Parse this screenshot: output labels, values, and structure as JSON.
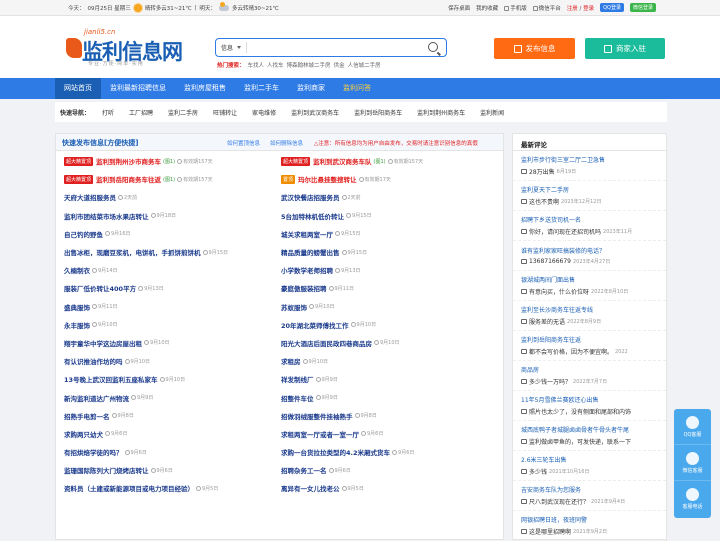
{
  "topbar": {
    "today_label": "今天：",
    "today_date": "09月25日 星期三",
    "w1": "晴转多云31~21℃",
    "tomorrow_label": "明天：",
    "w2": "多云转晴30~21℃",
    "links": [
      "保存桌面",
      "我的收藏",
      "手机版",
      "微信平台"
    ],
    "login": "注册",
    "sep": " / ",
    "reg": "登录",
    "qq": "QQ登录",
    "wx": "微信登录"
  },
  "logo": {
    "site": "jianli5.cn",
    "name": "监利信息网",
    "slogan": "专业·方便·简单·实用"
  },
  "search": {
    "select": "信息",
    "placeholder": ""
  },
  "hot": {
    "label": "热门搜索：",
    "items": [
      "车找人",
      "人找车",
      "博森翰林城二手房",
      "供金",
      "人信城二手房"
    ]
  },
  "buttons": {
    "post": "发布信息",
    "join": "商家入驻"
  },
  "nav": [
    "网站首页",
    "监利最新招聘信息",
    "监利房屋租售",
    "监利二手车",
    "监利商家",
    "监利问答"
  ],
  "quick": {
    "label": "快速导航：",
    "items": [
      "打听",
      "工厂招聘",
      "监利二手房",
      "旺铺转让",
      "家电维修",
      "监利到武汉商务车",
      "监利到岳阳商务车",
      "监利到荆州商务车",
      "监利新闻"
    ]
  },
  "main": {
    "title": "快速发布信息[方便快捷]",
    "lk1": "如何置顶信息",
    "lk2": "如何删除信息",
    "note": "△注意：所有信息均为用户自由发布，交易时请注意识别信息的真假",
    "left": [
      {
        "tag": "超大精置顶",
        "title": "监利到荆州沙市商务车",
        "red": true,
        "badge": "(图1)",
        "meta": "有效期157天"
      },
      {
        "tag": "超大精置顶",
        "title": "监利到岳阳商务车往返",
        "red": true,
        "badge": "(图1)",
        "meta": "有效期157天"
      },
      {
        "tag": "",
        "title": "天府大道招服务员",
        "red": false,
        "badge": "",
        "meta": "2天前"
      },
      {
        "tag": "",
        "title": "监利市团结菜市场水果店转让",
        "red": false,
        "badge": "",
        "meta": "9月18日"
      },
      {
        "tag": "",
        "title": "自己钓的野鱼",
        "red": false,
        "badge": "",
        "meta": "9月16日"
      },
      {
        "tag": "",
        "title": "出售冰柜，现磨豆浆机，电饼机，手抓饼煎饼机",
        "red": false,
        "badge": "",
        "meta": "9月15日"
      },
      {
        "tag": "",
        "title": "久楠制衣",
        "red": false,
        "badge": "",
        "meta": "9月14日"
      },
      {
        "tag": "",
        "title": "服装厂低价转让400平方",
        "red": false,
        "badge": "",
        "meta": "9月13日"
      },
      {
        "tag": "",
        "title": "盛典服饰",
        "red": false,
        "badge": "",
        "meta": "9月11日"
      },
      {
        "tag": "",
        "title": "永丰服饰",
        "red": false,
        "badge": "",
        "meta": "9月10日"
      },
      {
        "tag": "",
        "title": "翔宇童华中学这边房屋出租",
        "red": false,
        "badge": "",
        "meta": "9月10日"
      },
      {
        "tag": "",
        "title": "有认识推油作坊的吗",
        "red": false,
        "badge": "",
        "meta": "9月10日"
      },
      {
        "tag": "",
        "title": "13号晚上武汉回监利五座私家车",
        "red": false,
        "badge": "",
        "meta": "9月10日"
      },
      {
        "tag": "",
        "title": "新沟监利道达广州物流",
        "red": false,
        "badge": "",
        "meta": "9月9日"
      },
      {
        "tag": "",
        "title": "招熟手电剪一名",
        "red": false,
        "badge": "",
        "meta": "9月8日"
      },
      {
        "tag": "",
        "title": "求购两只幼犬",
        "red": false,
        "badge": "",
        "meta": "9月6日"
      },
      {
        "tag": "",
        "title": "有招烘焙学徒的吗？",
        "red": false,
        "badge": "",
        "meta": "9月6日"
      },
      {
        "tag": "",
        "title": "监珊国际陈列大门烧烤店转让",
        "red": false,
        "badge": "",
        "meta": "9月6日"
      },
      {
        "tag": "",
        "title": "资料员（土建或新能源项目或电力项目经验）",
        "red": false,
        "badge": "",
        "meta": "9月5日"
      }
    ],
    "right": [
      {
        "tag": "超大精置顶",
        "title": "监利到武汉商务车队",
        "red": true,
        "badge": "(图1)",
        "meta": "有效期157天"
      },
      {
        "tag": "置顶",
        "title": "玛尔比悬挂整搜转让",
        "red": true,
        "badge": "",
        "meta": "有效期17天"
      },
      {
        "tag": "",
        "title": "武汉快餐店招服务员",
        "red": false,
        "badge": "",
        "meta": "2天前"
      },
      {
        "tag": "",
        "title": "5台加特林机低价转让",
        "red": false,
        "badge": "",
        "meta": "9月15日"
      },
      {
        "tag": "",
        "title": "城关求租两室一厅",
        "red": false,
        "badge": "",
        "meta": "9月15日"
      },
      {
        "tag": "",
        "title": "精品质量的螃蟹出售",
        "red": false,
        "badge": "",
        "meta": "9月15日"
      },
      {
        "tag": "",
        "title": "小学数学老师招聘",
        "red": false,
        "badge": "",
        "meta": "9月13日"
      },
      {
        "tag": "",
        "title": "豪庭傲服装招聘",
        "red": false,
        "badge": "",
        "meta": "9月11日"
      },
      {
        "tag": "",
        "title": "苏蚁服饰",
        "red": false,
        "badge": "",
        "meta": "9月10日"
      },
      {
        "tag": "",
        "title": "20年湖北菜师傅找工作",
        "red": false,
        "badge": "",
        "meta": "9月10日"
      },
      {
        "tag": "",
        "title": "阳光大酒店后面民政四巷商品房",
        "red": false,
        "badge": "",
        "meta": "9月10日"
      },
      {
        "tag": "",
        "title": "求租房",
        "red": false,
        "badge": "",
        "meta": "9月10日"
      },
      {
        "tag": "",
        "title": "祥发制线厂",
        "red": false,
        "badge": "",
        "meta": "9月9日"
      },
      {
        "tag": "",
        "title": "招整件车位",
        "red": false,
        "badge": "",
        "meta": "9月9日"
      },
      {
        "tag": "",
        "title": "招做羽绒服整件挂袖熟手",
        "red": false,
        "badge": "",
        "meta": "9月8日"
      },
      {
        "tag": "",
        "title": "求租两室一厅或者一室一厅",
        "red": false,
        "badge": "",
        "meta": "9月6日"
      },
      {
        "tag": "",
        "title": "求购一台货拉拉类型的4.2米厢式货车",
        "red": false,
        "badge": "",
        "meta": "9月6日"
      },
      {
        "tag": "",
        "title": "招聘杂务工一名",
        "red": false,
        "badge": "",
        "meta": "9月6日"
      },
      {
        "tag": "",
        "title": "离异有一女儿找老公",
        "red": false,
        "badge": "",
        "meta": "9月5日"
      }
    ]
  },
  "side": {
    "title": "最新评论",
    "items": [
      {
        "a": "监利市步行街三室二厅二卫急售",
        "b": "28万出售",
        "d": "6月19日"
      },
      {
        "a": "监利夏天下二手房",
        "b": "这也不贵啊",
        "d": "2023年12月12日"
      },
      {
        "a": "招聘下乡送货司机一名",
        "b": "你好，请问现在还招司机吗",
        "d": "2023年11月"
      },
      {
        "a": "谁有监利家家旺搞装修的电话？",
        "b": "13687166679",
        "d": "2023年4月27日"
      },
      {
        "a": "银湖城两间门面出售",
        "b": "有意向买，什么价位呀",
        "d": "2022年8月10日"
      },
      {
        "a": "监利至长沙商务车往返专线",
        "b": "服务差的无语",
        "d": "2022年8月9日"
      },
      {
        "a": "监利到岳阳商务车往返",
        "b": "都不会写价格，因为不便宜啊。",
        "d": "2022"
      },
      {
        "a": "商品房",
        "b": "多少钱一万吗？",
        "d": "2022年7月7日"
      },
      {
        "a": "11年5月雪佛兰赛欧还心出售",
        "b": "照片也太少了，没有侧面和尾部和内饰",
        "d": ""
      },
      {
        "a": "城西底鸭子者城腿卤卤骨者牛骨头者牛尾",
        "b": "监利做卤甲鱼的，可发快递，联系一下",
        "d": ""
      },
      {
        "a": "2.6米三轮车出售",
        "b": "多少钱",
        "d": "2021年10月16日"
      },
      {
        "a": "吉安商务车队为您服务",
        "b": "尺八到武汉现在还行？",
        "d": "2021年9月4日"
      },
      {
        "a": "网银招聘日班，夜班同警",
        "b": "这是哪里招聘啊",
        "d": "2021年9月2日"
      }
    ]
  },
  "float": [
    "QQ客服",
    "微信客服",
    "客服电话"
  ]
}
